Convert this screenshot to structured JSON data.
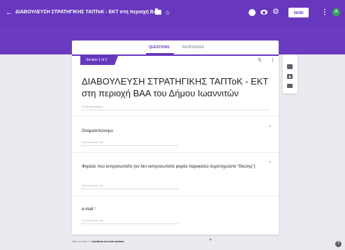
{
  "header": {
    "title": "ΔΙΑΒΟΥΛΕΥΣΗ ΣΤΡΑΤΗΓΙΚΗΣ ΤΑΠΤοΚ - ΕΚΤ στη περιοχή ΒΑ",
    "send_label": "SEND",
    "avatar_letter": "A",
    "accent_color": "#6738be"
  },
  "tabs": {
    "questions": "QUESTIONS",
    "responses": "RESPONSES"
  },
  "form": {
    "section_label": "Section 1 of 2",
    "title": "ΔΙΑΒΟΥΛΕΥΣΗ ΣΤΡΑΤΗΓΙΚΗΣ ΤΑΠΤοΚ - ΕΚΤ στη περιοχή ΒΑΑ του Δήμου Ιωαννιτών",
    "description_placeholder": "Form description",
    "questions": [
      {
        "label": "Ονοματεπώνυμο",
        "answer_placeholder": "Short answer text",
        "required": "*"
      },
      {
        "label": "Φορέας που εκπροσωπείτε (αν δεν εκπροσωπείτε φορέα παρακαλώ συμπληρώστε \"Ιδιώτης\")",
        "answer_placeholder": "Short answer text",
        "required": "*"
      },
      {
        "label": "e-mail",
        "answer_placeholder": "Short answer text",
        "required": "*"
      }
    ]
  },
  "footer": {
    "after_section_prefix": "After section 1",
    "after_section_value": "Continue to next section"
  },
  "icons": [
    "back-icon",
    "folder-icon",
    "star-icon",
    "palette-icon",
    "eye-icon",
    "gear-icon",
    "more-icon",
    "add-image-icon",
    "add-video-icon",
    "add-section-icon",
    "help-icon"
  ]
}
